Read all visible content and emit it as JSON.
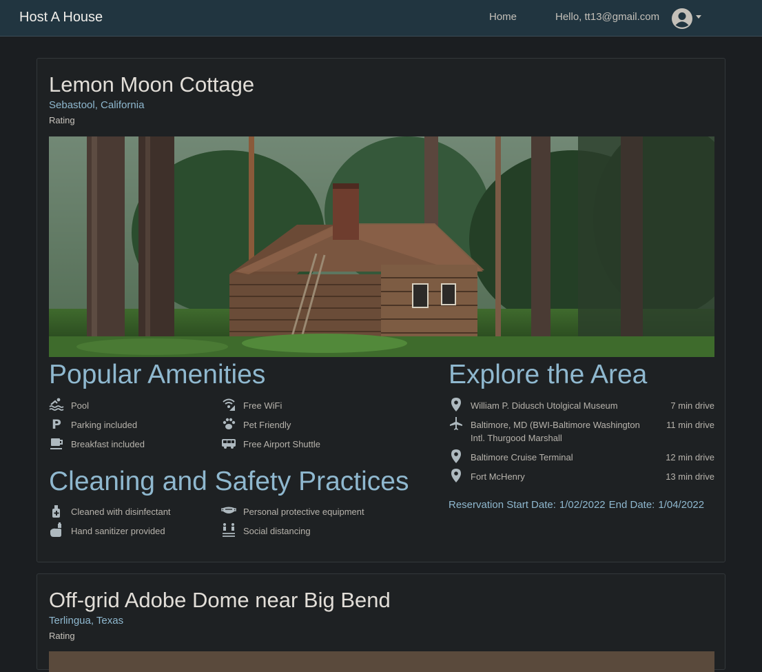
{
  "nav": {
    "brand": "Host A House",
    "home": "Home",
    "greeting": "Hello, tt13@gmail.com",
    "avatar_icon": "user-circle-icon"
  },
  "listings": [
    {
      "title": "Lemon Moon Cottage",
      "location": "Sebastool, California",
      "rating_label": "Rating",
      "photo_icon": "log-cabin-in-forest",
      "amenities_heading": "Popular Amenities",
      "amenities": [
        {
          "label": "Pool",
          "icon": "pool-icon"
        },
        {
          "label": "Free WiFi",
          "icon": "wifi-icon"
        },
        {
          "label": "Parking included",
          "icon": "parking-icon"
        },
        {
          "label": "Pet Friendly",
          "icon": "paw-icon"
        },
        {
          "label": "Breakfast included",
          "icon": "coffee-icon"
        },
        {
          "label": "Free Airport Shuttle",
          "icon": "shuttle-icon"
        }
      ],
      "cleaning_heading": "Cleaning and Safety Practices",
      "cleaning": [
        {
          "label": "Cleaned with disinfectant",
          "icon": "disinfectant-icon"
        },
        {
          "label": "Personal protective equipment",
          "icon": "mask-icon"
        },
        {
          "label": "Hand sanitizer provided",
          "icon": "hand-sanitizer-icon"
        },
        {
          "label": "Social distancing",
          "icon": "social-distancing-icon"
        }
      ],
      "explore_heading": "Explore the Area",
      "places": [
        {
          "name": "William P. Didusch Utolgical Museum",
          "distance": "7 min drive",
          "icon": "map-pin-icon"
        },
        {
          "name": "Baltimore, MD (BWI-Baltimore Washington Intl. Thurgood Marshall",
          "distance": "11 min drive",
          "icon": "airplane-icon"
        },
        {
          "name": "Baltimore Cruise Terminal",
          "distance": "12 min drive",
          "icon": "map-pin-icon"
        },
        {
          "name": "Fort McHenry",
          "distance": "13 min drive",
          "icon": "map-pin-icon"
        }
      ],
      "reservation": {
        "start_label": "Reservation Start Date:",
        "start": "1/02/2022",
        "end_label": "End Date:",
        "end": "1/04/2022"
      }
    },
    {
      "title": "Off-grid Adobe Dome near Big Bend",
      "location": "Terlingua, Texas",
      "rating_label": "Rating"
    }
  ],
  "colors": {
    "navbar": "#213540",
    "background": "#1b1e21",
    "card": "#1e2123",
    "accent": "#8fb8cf"
  }
}
